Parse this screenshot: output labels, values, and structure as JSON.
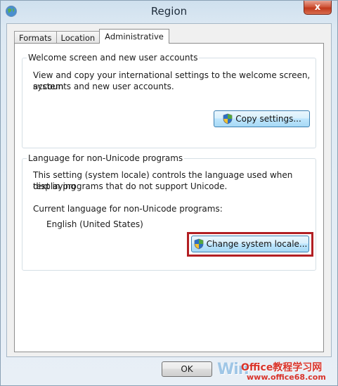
{
  "window": {
    "title": "Region",
    "close_glyph": "x",
    "app_icon": "globe-icon"
  },
  "tabs": [
    {
      "label": "Formats",
      "active": false
    },
    {
      "label": "Location",
      "active": false
    },
    {
      "label": "Administrative",
      "active": true
    }
  ],
  "welcome_group": {
    "title": "Welcome screen and new user accounts",
    "description_line1": "View and copy your international settings to the welcome screen, system",
    "description_line2": "accounts and new user accounts.",
    "button_label": "Copy settings...",
    "button_icon": "uac-shield-icon"
  },
  "non_unicode_group": {
    "title": "Language for non-Unicode programs",
    "description_line1": "This setting (system locale) controls the language used when displaying",
    "description_line2": "text in programs that do not support Unicode.",
    "current_label": "Current language for non-Unicode programs:",
    "current_value": "English (United States)",
    "button_label": "Change system locale...",
    "button_icon": "uac-shield-icon",
    "highlight_color": "#b21f23"
  },
  "footer": {
    "ok_label": "OK"
  },
  "watermark": {
    "left_text": "Win",
    "right_text": "Office教程学习网",
    "url": "www.office68.com"
  },
  "colors": {
    "accent_button": "#3c7fb1",
    "close_button": "#c1391c"
  }
}
